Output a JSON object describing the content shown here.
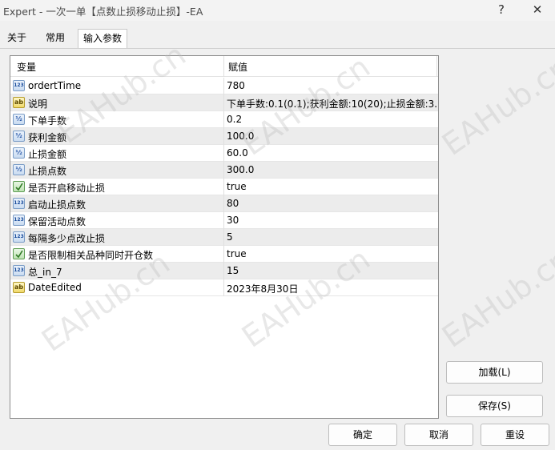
{
  "window": {
    "title": "Expert - 一次一单【点数止损移动止损】-EA",
    "help_label": "?",
    "close_label": "✕"
  },
  "tabs": [
    {
      "label": "关于"
    },
    {
      "label": "常用"
    },
    {
      "label": "输入参数"
    }
  ],
  "grid": {
    "headers": {
      "name": "变量",
      "value": "赋值"
    },
    "rows": [
      {
        "type": "int",
        "icon_text": "123",
        "name": "ordertTime",
        "value": "780"
      },
      {
        "type": "string",
        "icon_text": "ab",
        "name": "说明",
        "value": "下单手数:0.1(0.1);获利金额:10(20);止损金额:3..."
      },
      {
        "type": "double",
        "icon_text": "½",
        "name": "下单手数",
        "value": "0.2"
      },
      {
        "type": "double",
        "icon_text": "½",
        "name": "获利金额",
        "value": "100.0"
      },
      {
        "type": "double",
        "icon_text": "½",
        "name": "止损金额",
        "value": "60.0"
      },
      {
        "type": "double",
        "icon_text": "½",
        "name": "止损点数",
        "value": "300.0"
      },
      {
        "type": "bool",
        "icon_text": "",
        "name": "是否开启移动止损",
        "value": "true"
      },
      {
        "type": "int",
        "icon_text": "123",
        "name": "启动止损点数",
        "value": "80"
      },
      {
        "type": "int",
        "icon_text": "123",
        "name": "保留活动点数",
        "value": "30"
      },
      {
        "type": "int",
        "icon_text": "123",
        "name": "每隔多少点改止损",
        "value": "5"
      },
      {
        "type": "bool",
        "icon_text": "",
        "name": "是否限制相关品种同时开仓数",
        "value": "true"
      },
      {
        "type": "int",
        "icon_text": "123",
        "name": "总_in_7",
        "value": "15"
      },
      {
        "type": "string",
        "icon_text": "ab",
        "name": "DateEdited",
        "value": "2023年8月30日"
      }
    ]
  },
  "side_buttons": {
    "load": "加载(L)",
    "save": "保存(S)"
  },
  "footer_buttons": {
    "ok": "确定",
    "cancel": "取消",
    "reset": "重设"
  },
  "watermark": "EAHub.cn"
}
